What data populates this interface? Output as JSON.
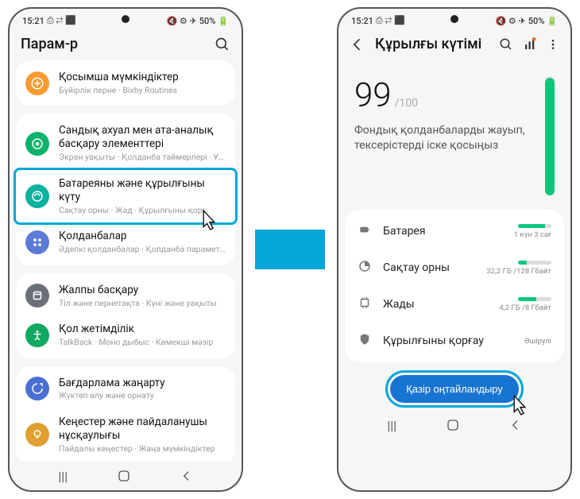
{
  "status": {
    "time": "15:21",
    "battery": "50%"
  },
  "left": {
    "title": "Парам-р",
    "items": [
      {
        "title": "Қосымша мүмкіндіктер",
        "sub": "Бүйірлік перне · Bixby Routines",
        "color": "#f79b2f",
        "icon": "plus"
      },
      {
        "title": "Сандық ахуал мен ата-аналық басқару элементтері",
        "sub": "Экран уақыты · Қолданба таймерлері · Ұйықтау уақыты режимі",
        "color": "#0bb36a",
        "icon": "wellbeing"
      },
      {
        "title": "Батареяны және құрылғыны күту",
        "sub": "Сақтау орны · Жад · Құрылғыны қорғ",
        "color": "#0bb3a0",
        "icon": "care",
        "highlighted": true
      },
      {
        "title": "Қолданбалар",
        "sub": "Әдепкі қолданбалар · Қолданба параметрлері",
        "color": "#5b7bd6",
        "icon": "apps"
      },
      {
        "title": "Жалпы басқару",
        "sub": "Тіл және пернетақта · Күні және уақыты",
        "color": "#6b6f78",
        "icon": "general"
      },
      {
        "title": "Қол жетімділік",
        "sub": "TalkBack · Моно дыбыс · Көмекші мәзір",
        "color": "#11a861",
        "icon": "accessibility"
      },
      {
        "title": "Бағдарлама жаңарту",
        "sub": "Жүктеп алу және орнату",
        "color": "#4a6fd4",
        "icon": "update"
      },
      {
        "title": "Кеңестер және пайдаланушы нұсқаулығы",
        "sub": "Пайдалы кеңестер · Жаңа мүмкіндіктер",
        "color": "#e0a030",
        "icon": "tips"
      }
    ]
  },
  "right": {
    "title": "Құрылғы күтімі",
    "score": "99",
    "scoreMax": "/100",
    "scoreMsg": "Фондық қолданбаларды жауып, тексерістерді іске қосыңыз",
    "scoreFill": 99,
    "rows": [
      {
        "label": "Батарея",
        "txt": "1 күн 3 сағ",
        "fill": 80,
        "icon": "battery"
      },
      {
        "label": "Сақтау орны",
        "txt": "32,2 ГБ /128 Гбайт",
        "fill": 26,
        "icon": "storage"
      },
      {
        "label": "Жады",
        "txt": "4,2 ГБ /8 Гбайт",
        "fill": 55,
        "icon": "memory"
      },
      {
        "label": "Құрылғыны қорғау",
        "txt": "Өшірулі",
        "nobar": true,
        "icon": "shield"
      }
    ],
    "optimize": "Қазір оңтайландыру"
  }
}
